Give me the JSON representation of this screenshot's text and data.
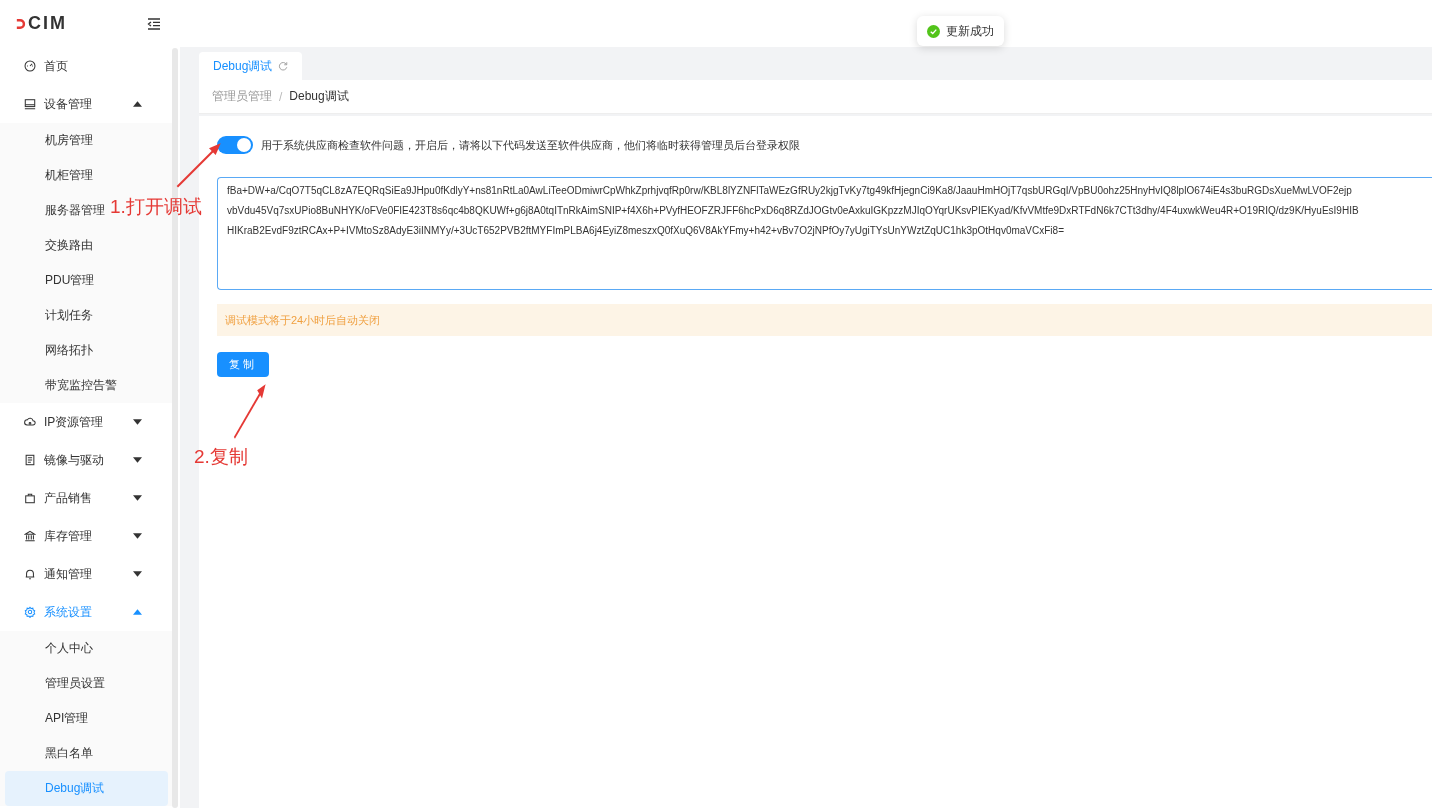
{
  "header": {
    "logo": "CIM"
  },
  "toast": {
    "text": "更新成功"
  },
  "sidebar": {
    "items": [
      {
        "label": "首页",
        "kind": "item",
        "selected": false
      },
      {
        "label": "设备管理",
        "kind": "group",
        "expanded": true,
        "selected": false,
        "children": [
          {
            "label": "机房管理",
            "selected": false
          },
          {
            "label": "机柜管理",
            "selected": false
          },
          {
            "label": "服务器管理",
            "selected": false
          },
          {
            "label": "交换路由",
            "selected": false
          },
          {
            "label": "PDU管理",
            "selected": false
          },
          {
            "label": "计划任务",
            "selected": false
          },
          {
            "label": "网络拓扑",
            "selected": false
          },
          {
            "label": "带宽监控告警",
            "selected": false
          }
        ]
      },
      {
        "label": "IP资源管理",
        "kind": "group",
        "expanded": false,
        "selected": false
      },
      {
        "label": "镜像与驱动",
        "kind": "group",
        "expanded": false,
        "selected": false
      },
      {
        "label": "产品销售",
        "kind": "group",
        "expanded": false,
        "selected": false
      },
      {
        "label": "库存管理",
        "kind": "group",
        "expanded": false,
        "selected": false
      },
      {
        "label": "通知管理",
        "kind": "group",
        "expanded": false,
        "selected": false
      },
      {
        "label": "系统设置",
        "kind": "group",
        "expanded": true,
        "selected": true,
        "children": [
          {
            "label": "个人中心",
            "selected": false
          },
          {
            "label": "管理员设置",
            "selected": false
          },
          {
            "label": "API管理",
            "selected": false
          },
          {
            "label": "黑白名单",
            "selected": false
          },
          {
            "label": "Debug调试",
            "selected": true
          }
        ]
      }
    ]
  },
  "tabs": [
    {
      "label": "Debug调试",
      "selected": true
    }
  ],
  "breadcrumb": [
    "管理员管理",
    "Debug调试"
  ],
  "breadcrumb_separator": "/",
  "debug": {
    "on": true,
    "description": "用于系统供应商检查软件问题，开启后，请将以下代码发送至软件供应商，他们将临时获得管理员后台登录权限",
    "code_lines": [
      "fBa+DW+a/CqO7T5qCL8zA7EQRqSiEa9JHpu0fKdlyY+ns81nRtLa0AwLiTeeODmiwrCpWhkZprhjvqfRp0rw/KBL8lYZNFlTaWEzGfRUy2kjgTvKy7tg49kfHjegnCi9Ka8/JaauHmHOjT7qsbURGqI/VpBU0ohz25HnyHvIQ8lplO674iE4s3buRGDsXueMwLVOF2ejp",
      "vbVdu45Vq7sxUPio8BuNHYK/oFVe0FIE423T8s6qc4b8QKUWf+g6j8A0tqITnRkAimSNIP+f4X6h+PVyfHEOFZRJFF6hcPxD6q8RZdJOGtv0eAxkuIGKpzzMJIqOYqrUKsvPIEKyad/KfvVMtfe9DxRTFdN6k7CTt3dhy/4F4uxwkWeu4R+O19RIQ/dz9K/HyuEsI9HIB",
      "HIKraB2EvdF9ztRCAx+P+IVMtoSz8AdyE3iINMYy/+3UcT652PVB2ftMYFImPLBA6j4EyiZ8meszxQ0fXuQ6V8AkYFmy+h42+vBv7O2jNPfOy7yUgiTYsUnYWztZqUC1hk3pOtHqv0maVCxFi8="
    ],
    "notice": "调试模式将于24小时后自动关闭",
    "copy_button": "复制"
  },
  "annotations": [
    {
      "text": "1.打开调试"
    },
    {
      "text": "2.复制"
    }
  ]
}
